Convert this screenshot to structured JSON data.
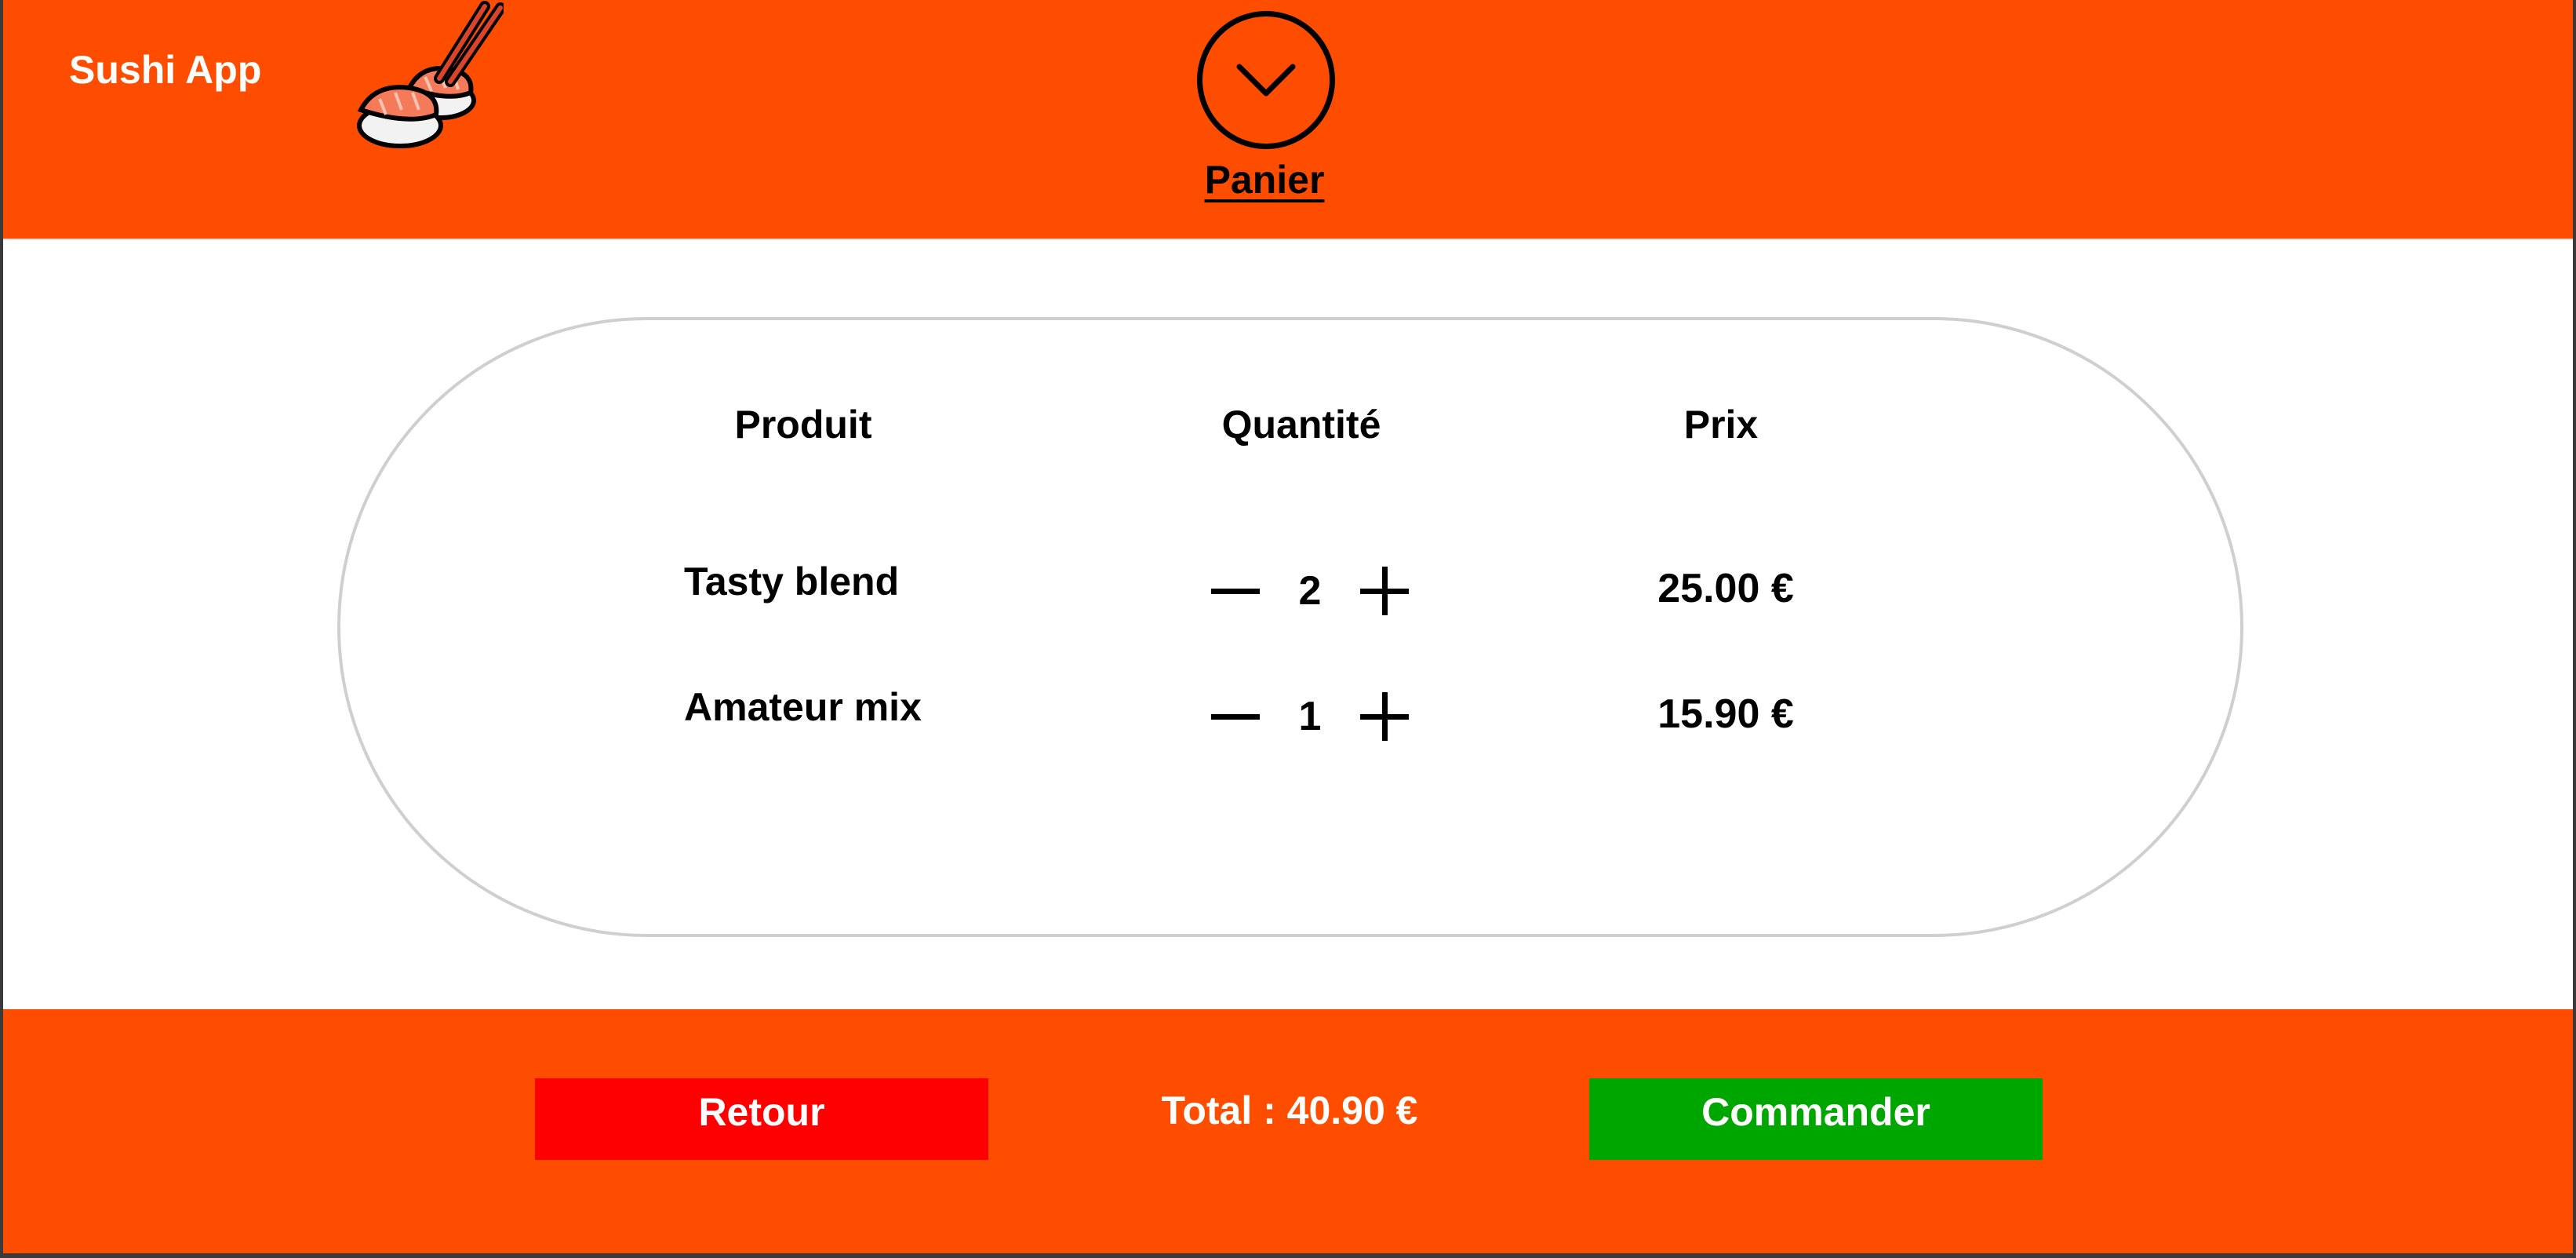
{
  "header": {
    "app_title": "Sushi App",
    "logo_icon": "sushi-chopsticks-icon",
    "collapse_icon": "chevron-down-icon",
    "cart_title": "Panier"
  },
  "cart": {
    "columns": {
      "product": "Produit",
      "quantity": "Quantité",
      "price": "Prix"
    },
    "items": [
      {
        "name": "Tasty blend",
        "quantity": "2",
        "price": "25.00 €"
      },
      {
        "name": "Amateur mix",
        "quantity": "1",
        "price": "15.90 €"
      }
    ]
  },
  "footer": {
    "back_label": "Retour",
    "total_label": "Total : 40.90 €",
    "order_label": "Commander"
  },
  "colors": {
    "brand_orange": "#ff4d00",
    "back_red": "#ff0000",
    "order_green": "#00a600"
  }
}
